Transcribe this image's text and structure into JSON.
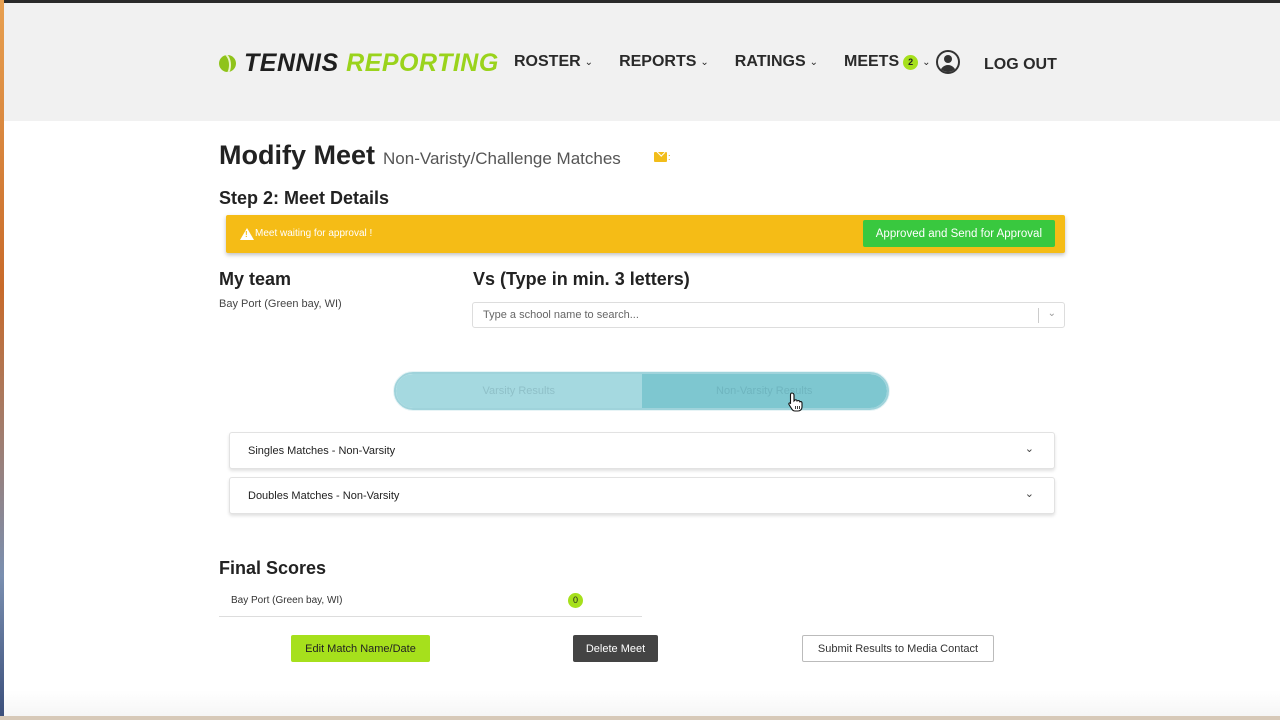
{
  "header": {
    "logo_part1": "TENNIS",
    "logo_part2": "REPORTING",
    "nav": [
      {
        "label": "ROSTER"
      },
      {
        "label": "REPORTS"
      },
      {
        "label": "RATINGS"
      },
      {
        "label": "MEETS",
        "badge": "2"
      }
    ],
    "logout_label": "LOG OUT"
  },
  "page": {
    "title": "Modify Meet",
    "subtitle": "Non-Varisty/Challenge Matches",
    "step": "Step 2: Meet Details"
  },
  "alert": {
    "message": "Meet waiting for approval !",
    "button_label": "Approved and Send for Approval"
  },
  "my_team": {
    "heading": "My team",
    "value": "Bay Port (Green bay, WI)"
  },
  "opponent": {
    "heading": "Vs (Type in min. 3 letters)",
    "placeholder": "Type a school name to search..."
  },
  "toggle": {
    "option1": "Varsity Results",
    "option2": "Non-Varsity Results"
  },
  "accordions": [
    {
      "label": "Singles Matches - Non-Varsity"
    },
    {
      "label": "Doubles Matches - Non-Varsity"
    }
  ],
  "final_scores": {
    "heading": "Final Scores",
    "rows": [
      {
        "team": "Bay Port (Green bay, WI)",
        "score": "0"
      }
    ]
  },
  "buttons": {
    "edit": "Edit Match Name/Date",
    "delete": "Delete Meet",
    "submit": "Submit Results to Media Contact"
  },
  "colors": {
    "brand_green": "#9ad31c",
    "alert_yellow": "#f5bc16",
    "approve_green": "#39c83f",
    "toggle_teal": "#7ec7d0"
  }
}
